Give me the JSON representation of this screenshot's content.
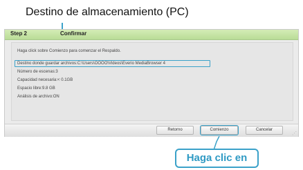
{
  "annotations": {
    "destination_label": "Destino de almacenamiento (PC)",
    "click_label": "Haga clic en"
  },
  "header": {
    "step": "Step 2",
    "title": "Confirmar"
  },
  "content": {
    "instruction": "Haga click sobre Comienzo para comenzar el Respaldo.",
    "destination": "Destino donde guardar archivos:C:\\Users\\OOOO\\Videos\\Everio MediaBrowser 4",
    "scenes": "Número de escenas:3",
    "capacity": "Capacidad necesaria:< 0.1GB",
    "free_space": "Espacio libre:9.8 GB",
    "analysis": "Análisis de archivo:ON"
  },
  "buttons": {
    "back": "Retorno",
    "start": "Comienzo",
    "cancel": "Cancelar"
  },
  "colors": {
    "accent": "#3aa1c9",
    "header_green": "#c6e3a8"
  }
}
